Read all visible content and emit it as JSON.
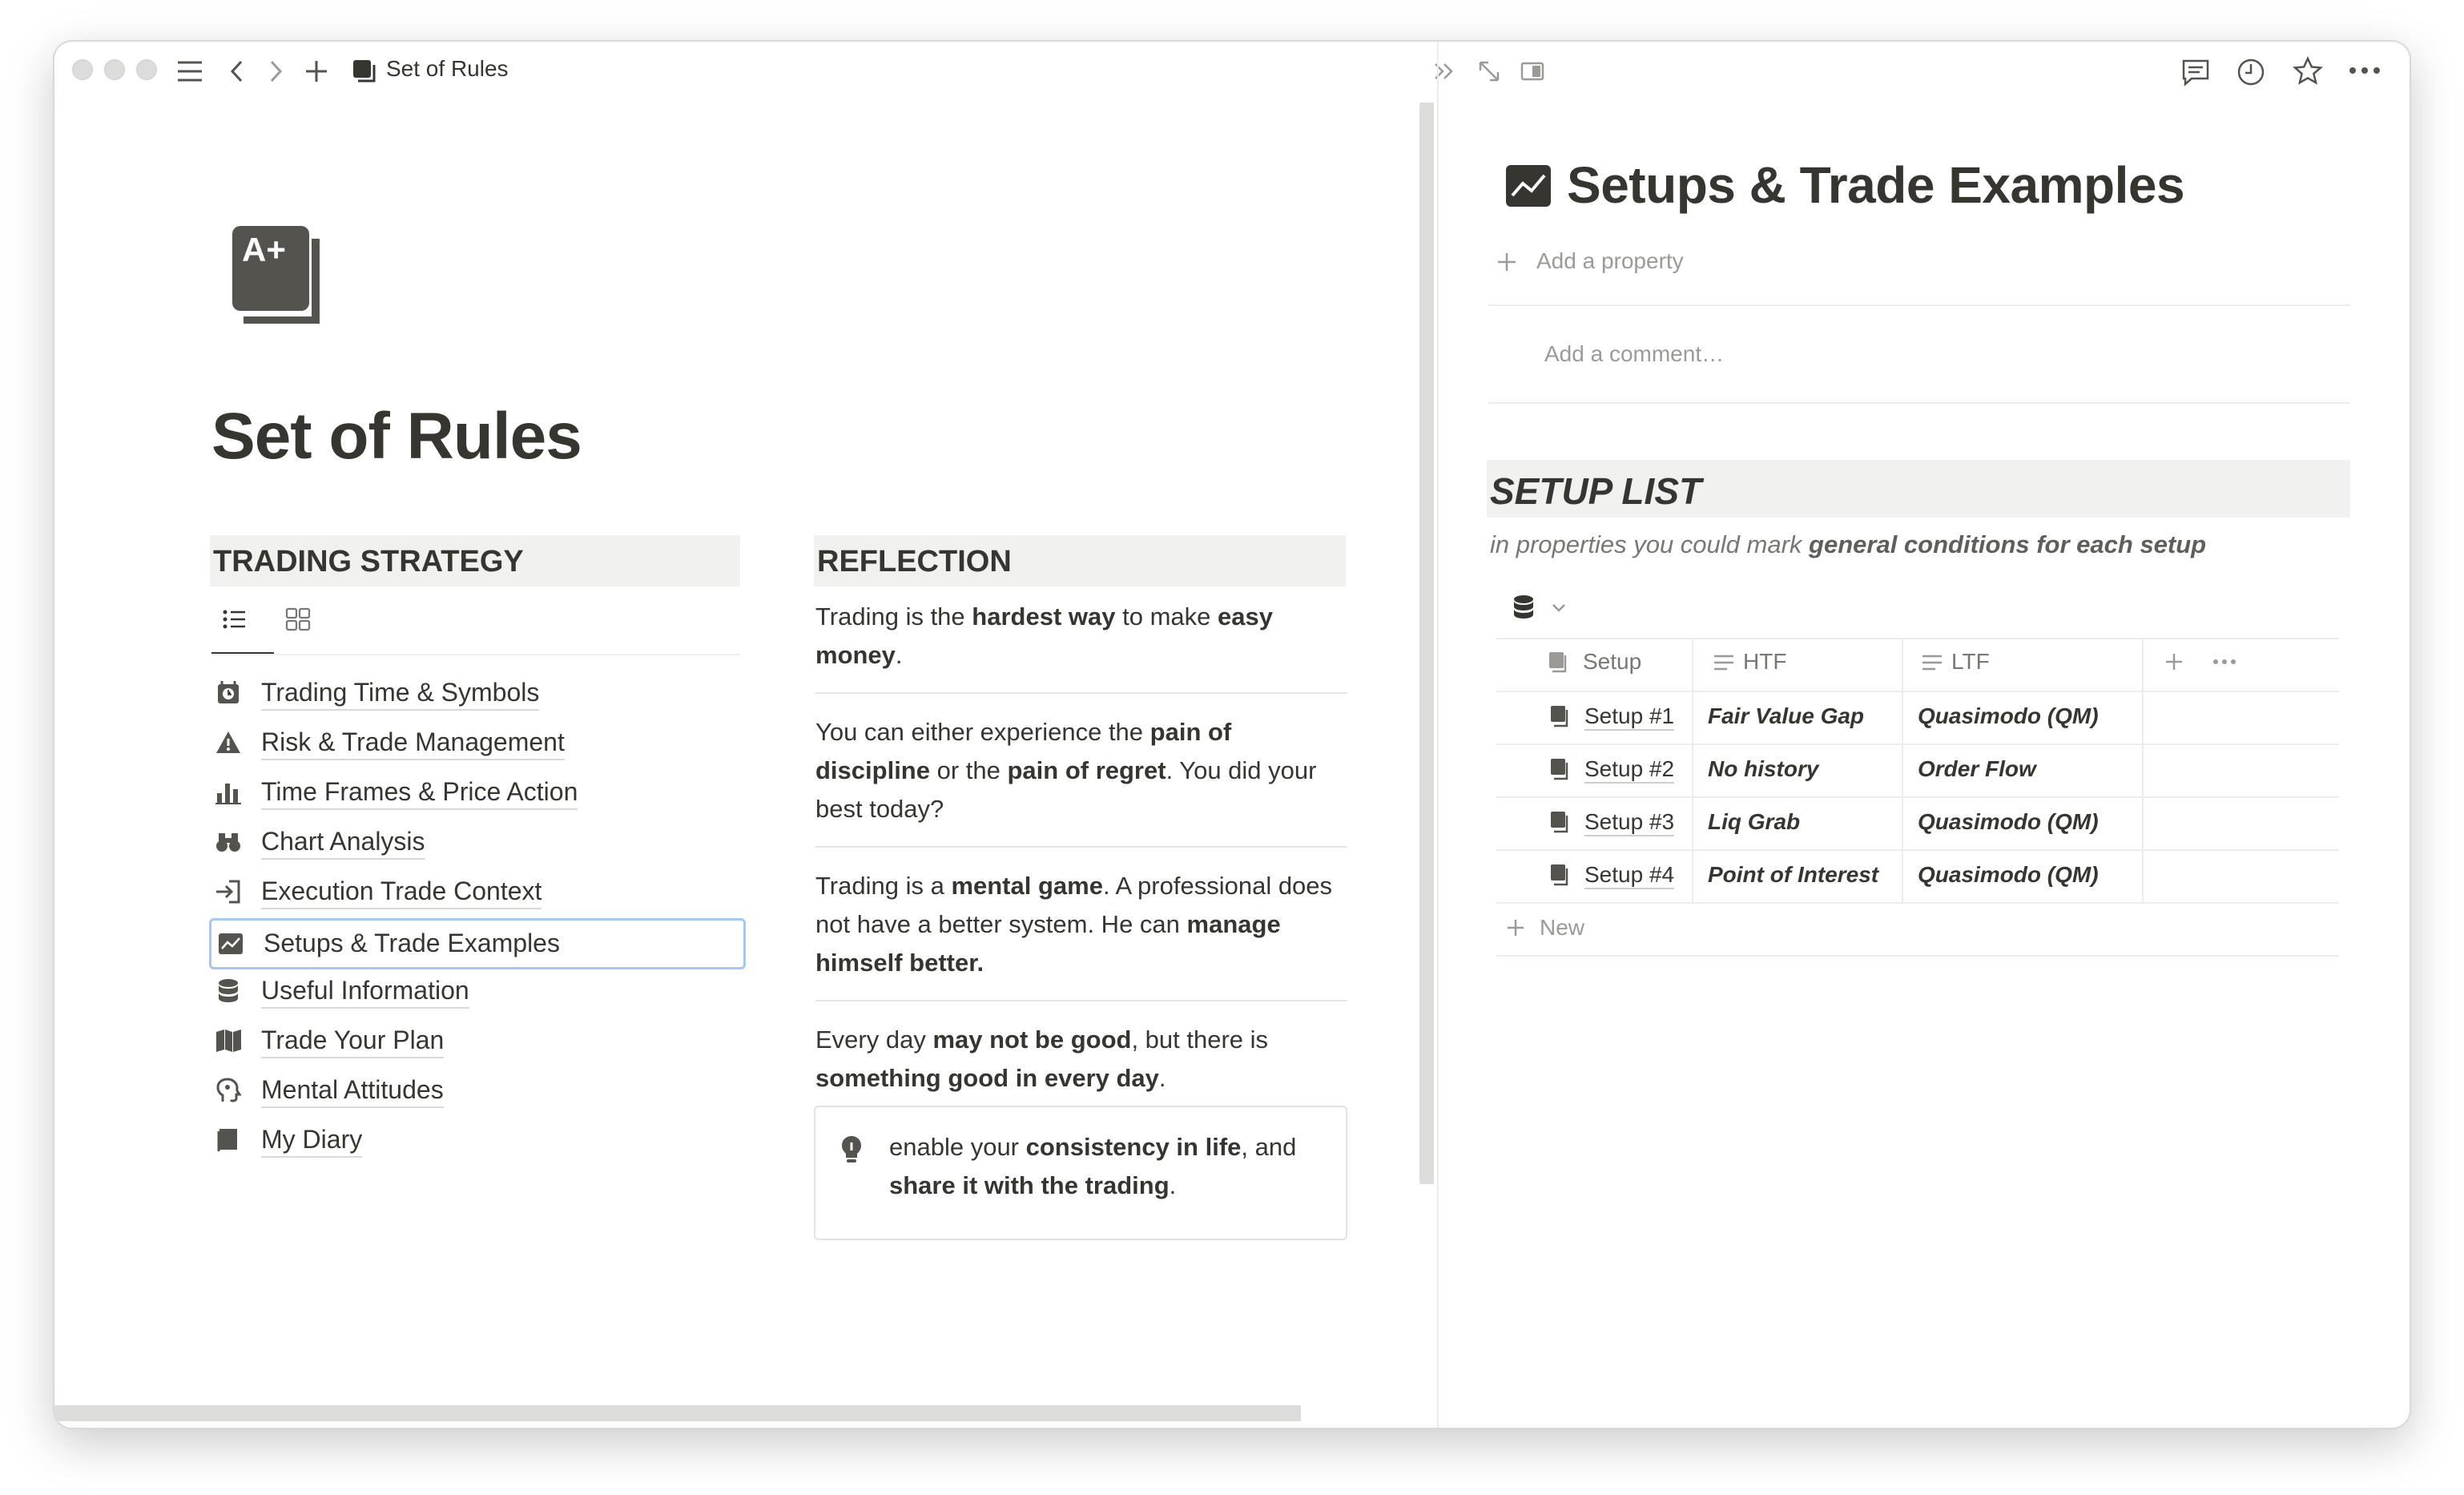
{
  "topbar": {
    "page_title": "Set of Rules"
  },
  "left_page": {
    "title": "Set of Rules",
    "strategy": {
      "heading": "TRADING STRATEGY",
      "items": [
        {
          "label": "Trading Time & Symbols",
          "icon": "time-icon"
        },
        {
          "label": "Risk & Trade Management",
          "icon": "warning-icon"
        },
        {
          "label": "Time Frames & Price Action",
          "icon": "bar-chart-icon"
        },
        {
          "label": "Chart Analysis",
          "icon": "binoculars-icon"
        },
        {
          "label": "Execution Trade Context",
          "icon": "enter-icon"
        },
        {
          "label": "Setups & Trade Examples",
          "icon": "trend-icon"
        },
        {
          "label": "Useful Information",
          "icon": "database-icon"
        },
        {
          "label": "Trade Your Plan",
          "icon": "map-icon"
        },
        {
          "label": "Mental Attitudes",
          "icon": "head-icon"
        },
        {
          "label": "My Diary",
          "icon": "book-icon"
        }
      ]
    },
    "reflection": {
      "heading": "REFLECTION",
      "callout": "enable your consistency in life, and share it with the trading."
    }
  },
  "right_page": {
    "title": "Setups & Trade Examples",
    "add_property": "Add a property",
    "comment_placeholder": "Add a comment…",
    "section_heading": "SETUP LIST",
    "subtitle_pre": "in properties you could mark ",
    "subtitle_bold": "general conditions for each setup",
    "table": {
      "columns": [
        "Setup",
        "HTF",
        "LTF"
      ],
      "rows": [
        {
          "setup": "Setup #1",
          "htf": "Fair Value Gap",
          "ltf": "Quasimodo (QM)"
        },
        {
          "setup": "Setup #2",
          "htf": "No history",
          "ltf": "Order Flow"
        },
        {
          "setup": "Setup #3",
          "htf": "Liq Grab",
          "ltf": "Quasimodo (QM)"
        },
        {
          "setup": "Setup #4",
          "htf": "Point of Interest",
          "ltf": "Quasimodo (QM)"
        }
      ],
      "new_label": "New"
    }
  }
}
